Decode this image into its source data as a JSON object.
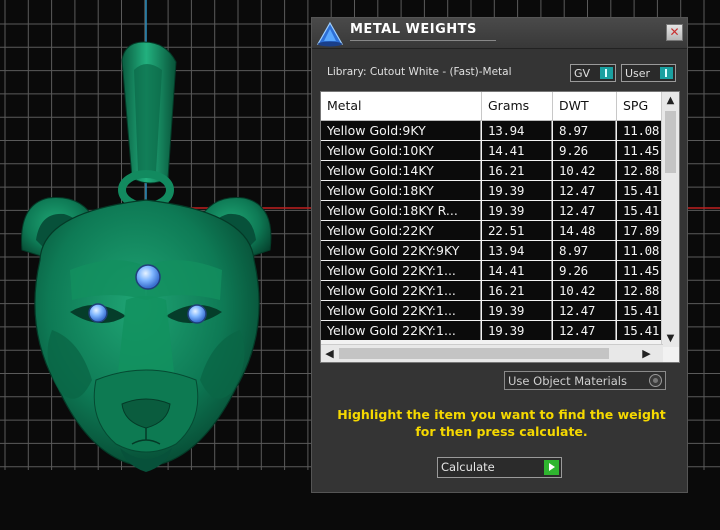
{
  "viewport": {
    "background": "#0a0a0a",
    "grid_color": "#5a5a5a",
    "axis_x_color": "#c02020",
    "axis_y_color": "#2a90c0",
    "model_color": "#0e7a55",
    "gem_color": "#7fb6ff"
  },
  "panel": {
    "title": "METAL WEIGHTS",
    "close_glyph": "✕",
    "library_label": "Library: Cutout White - (Fast)-Metal",
    "gv_select": {
      "value": "GV"
    },
    "user_select": {
      "value": "User"
    },
    "table": {
      "columns": [
        "Metal",
        "Grams",
        "DWT",
        "SPG"
      ],
      "rows": [
        [
          "Yellow Gold:9KY",
          "13.94",
          "8.97",
          "11.08"
        ],
        [
          "Yellow Gold:10KY",
          "14.41",
          "9.26",
          "11.45"
        ],
        [
          "Yellow Gold:14KY",
          "16.21",
          "10.42",
          "12.88"
        ],
        [
          "Yellow Gold:18KY",
          "19.39",
          "12.47",
          "15.41"
        ],
        [
          "Yellow Gold:18KY R...",
          "19.39",
          "12.47",
          "15.41"
        ],
        [
          "Yellow Gold:22KY",
          "22.51",
          "14.48",
          "17.89"
        ],
        [
          "Yellow Gold 22KY:9KY",
          "13.94",
          "8.97",
          "11.08"
        ],
        [
          "Yellow Gold 22KY:1...",
          "14.41",
          "9.26",
          "11.45"
        ],
        [
          "Yellow Gold 22KY:1...",
          "16.21",
          "10.42",
          "12.88"
        ],
        [
          "Yellow Gold 22KY:1...",
          "19.39",
          "12.47",
          "15.41"
        ],
        [
          "Yellow Gold 22KY:1...",
          "19.39",
          "12.47",
          "15.41"
        ]
      ]
    },
    "use_object_materials": "Use Object Materials",
    "instruction_line1": "Highlight the item you want to find the weight",
    "instruction_line2": "for then press calculate.",
    "calculate_label": "Calculate"
  }
}
